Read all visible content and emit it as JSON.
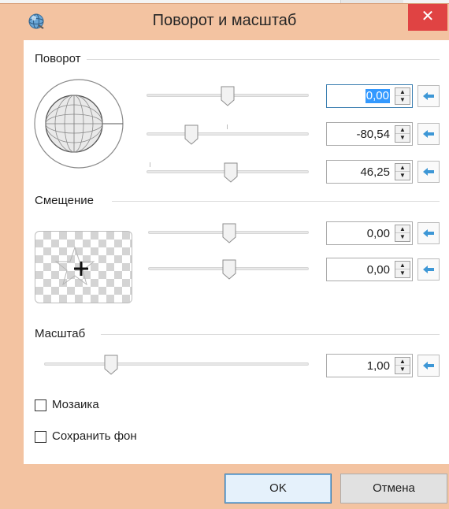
{
  "window": {
    "title": "Поворот и масштаб",
    "close_glyph": "✕"
  },
  "rotation": {
    "label": "Поворот",
    "rows": [
      {
        "value": "0,00",
        "selected": true,
        "slider_fraction": 0.5
      },
      {
        "value": "-80,54",
        "selected": false,
        "slider_fraction": 0.28
      },
      {
        "value": "46,25",
        "selected": false,
        "slider_fraction": 0.52
      }
    ]
  },
  "offset": {
    "label": "Смещение",
    "rows": [
      {
        "value": "0,00",
        "slider_fraction": 0.5
      },
      {
        "value": "0,00",
        "slider_fraction": 0.5
      }
    ]
  },
  "scale": {
    "label": "Масштаб",
    "value": "1,00",
    "slider_fraction": 0.24
  },
  "checkboxes": {
    "tile": {
      "label": "Мозаика",
      "checked": false
    },
    "keep_background": {
      "label": "Сохранить фон",
      "checked": false
    }
  },
  "buttons": {
    "ok": "OK",
    "cancel": "Отмена"
  },
  "icons": {
    "spin_up": "▲",
    "spin_down": "▼",
    "reset": "reset-arrow-icon",
    "app": "app-globe-icon",
    "move": "move-cross-icon"
  },
  "colors": {
    "title_bar": "#f3c3a1",
    "close": "#e04343",
    "accent": "#3399ff",
    "reset_arrow": "#3d97d6"
  }
}
